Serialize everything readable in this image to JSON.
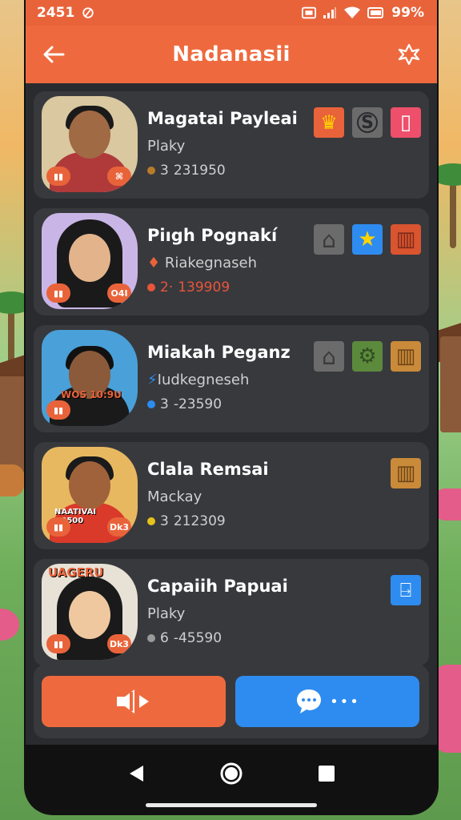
{
  "status_bar": {
    "time": "2451",
    "battery": "99%"
  },
  "app_bar": {
    "title": "Nadanasii"
  },
  "contacts": [
    {
      "name": "Magatai Payleai",
      "subtitle": "Plaky",
      "stat_count": "3",
      "stat_value": "231950",
      "stat_color": "#b97a2a",
      "photo_left_badge": "▮▮",
      "photo_right_badge": "⌘",
      "actions": [
        {
          "icon": "crown-icon",
          "color": "#e9633a",
          "glyph": "♛",
          "glyph_color": "#ffd400"
        },
        {
          "icon": "s-coin-icon",
          "color": "#6b6b6b",
          "glyph": "S",
          "glyph_color": "#2a2b2f"
        },
        {
          "icon": "phone-icon",
          "color": "#ee4f6b",
          "glyph": "▯",
          "glyph_color": "#ffffff"
        }
      ]
    },
    {
      "name": "Piıgh Pognakí",
      "subtitle": "Riakegnaseh",
      "stat_count": "2·",
      "stat_value": "139909",
      "stat_color": "#e8553a",
      "stat_red": true,
      "photo_left_badge": "▮▮",
      "photo_right_badge": "O4I",
      "actions": [
        {
          "icon": "home-icon",
          "color": "#6b6b6b",
          "glyph": "⌂",
          "glyph_color": "#3a3a3a"
        },
        {
          "icon": "star-icon",
          "color": "#2e8cf0",
          "glyph": "★",
          "glyph_color": "#ffd400"
        },
        {
          "icon": "trash-icon",
          "color": "#d9542f",
          "glyph": "▥",
          "glyph_color": "#7a2a1a"
        }
      ]
    },
    {
      "name": "Miakah Peganz",
      "subtitle": "Iudkegneseh",
      "stat_count": "3",
      "stat_value": "-23590",
      "stat_color": "#2e8cf0",
      "photo_left_badge": "▮▮",
      "photo_right_badge": "",
      "photo_banner": "WOS 10:9U",
      "actions": [
        {
          "icon": "home-icon",
          "color": "#6b6b6b",
          "glyph": "⌂",
          "glyph_color": "#3a3a3a"
        },
        {
          "icon": "gear-icon",
          "color": "#5c8a3c",
          "glyph": "⚙",
          "glyph_color": "#2f4d1f"
        },
        {
          "icon": "trash-icon",
          "color": "#c98a3a",
          "glyph": "▥",
          "glyph_color": "#6b4416"
        }
      ]
    },
    {
      "name": "Clala Remsai",
      "subtitle": "Mackay",
      "stat_count": "3",
      "stat_value": "212309",
      "stat_color": "#e6c21c",
      "photo_left_badge": "▮▮",
      "photo_right_badge": "Dk3",
      "photo_banner": "NAATIVAI +0500",
      "actions": [
        {
          "icon": "trash-icon",
          "color": "#c98a3a",
          "glyph": "▥",
          "glyph_color": "#6b4416"
        }
      ]
    },
    {
      "name": "Capaiih Papuai",
      "subtitle": "Plaky",
      "stat_count": "6",
      "stat_value": "-45590",
      "stat_color": "#9a9a9a",
      "photo_left_badge": "▮▮",
      "photo_right_badge": "Dk3",
      "photo_banner": "UAGERU",
      "actions": [
        {
          "icon": "exit-door-icon",
          "color": "#2e8cf0",
          "glyph": "⍈",
          "glyph_color": "#ffffff"
        }
      ]
    }
  ],
  "bottom_actions": {
    "audio_button_icon": "speaker-icon",
    "chat_button_icon": "chat-bubble-icon",
    "chat_dots": "•••"
  }
}
